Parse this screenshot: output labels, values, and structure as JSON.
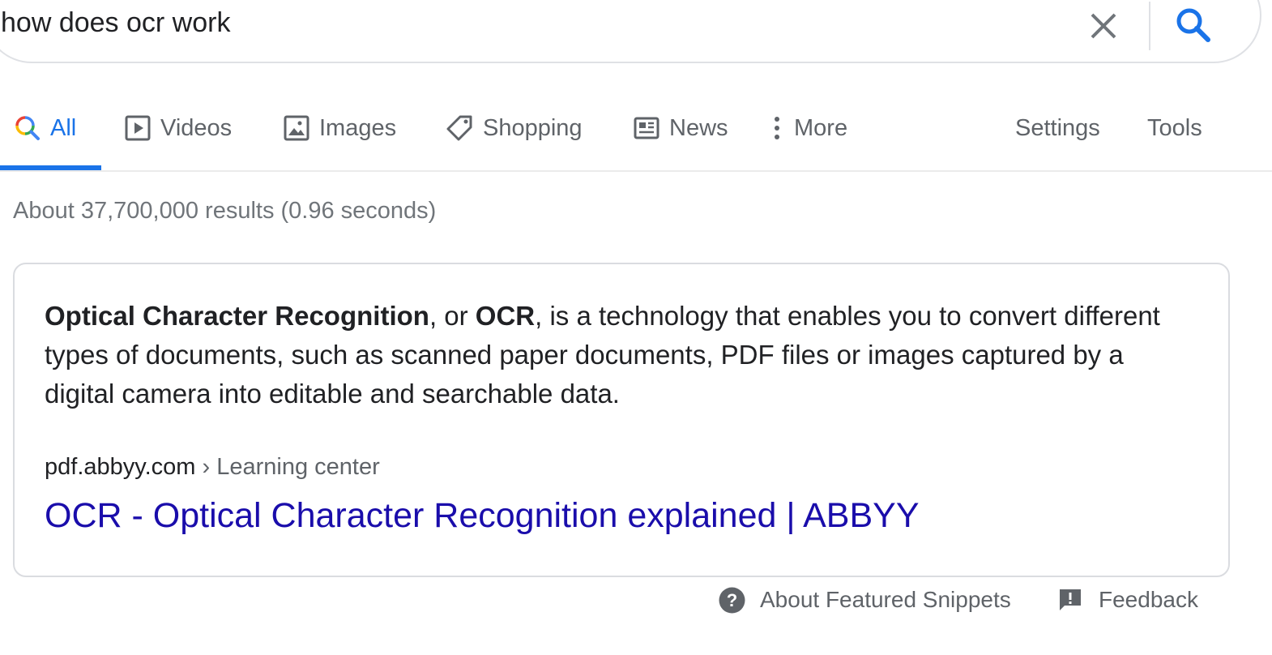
{
  "search": {
    "query": "how does ocr work"
  },
  "tabs": [
    {
      "label": "All",
      "icon": "search-multicolor-icon",
      "active": true
    },
    {
      "label": "Videos",
      "icon": "play-icon"
    },
    {
      "label": "Images",
      "icon": "image-icon"
    },
    {
      "label": "Shopping",
      "icon": "tag-icon"
    },
    {
      "label": "News",
      "icon": "newspaper-icon"
    },
    {
      "label": "More",
      "icon": "vertical-dots-icon"
    }
  ],
  "tools": {
    "settings": "Settings",
    "tools": "Tools"
  },
  "stats": "About 37,700,000 results (0.96 seconds)",
  "snippet": {
    "bold1": "Optical Character Recognition",
    "text1": ", or ",
    "bold2": "OCR",
    "text2": ", is a technology that enables you to convert different types of documents, such as scanned paper documents, PDF files or images captured by a digital camera into editable and searchable data.",
    "cite_domain": "pdf.abbyy.com",
    "cite_path": " › Learning center",
    "title": "OCR - Optical Character Recognition explained | ABBYY"
  },
  "footer": {
    "about": "About Featured Snippets",
    "feedback": "Feedback"
  },
  "colors": {
    "link": "#1a0dab",
    "accent": "#1a73e8",
    "muted": "#5f6368"
  }
}
